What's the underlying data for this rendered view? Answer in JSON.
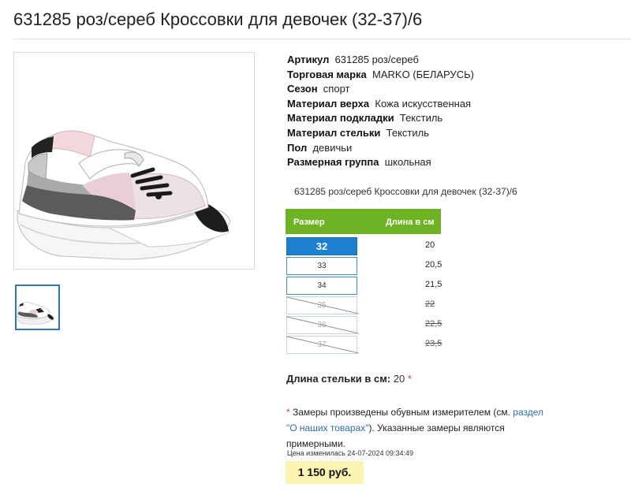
{
  "product": {
    "title": "631285 роз/сереб Кроссовки для девочек (32-37)/6",
    "subtitle": "631285 роз/сереб Кроссовки для девочек (32-37)/6",
    "image_alt": "sneaker-photo"
  },
  "properties": [
    {
      "key": "Артикул",
      "value": "631285 роз/сереб"
    },
    {
      "key": "Торговая марка",
      "value": "MARKO (БЕЛАРУСЬ)"
    },
    {
      "key": "Сезон",
      "value": "спорт"
    },
    {
      "key": "Материал верха",
      "value": "Кожа искусственная"
    },
    {
      "key": "Материал подкладки",
      "value": "Текстиль"
    },
    {
      "key": "Материал стельки",
      "value": "Текстиль"
    },
    {
      "key": "Пол",
      "value": "девичьи"
    },
    {
      "key": "Размерная группа",
      "value": "школьная"
    }
  ],
  "size_table": {
    "header_size": "Размер",
    "header_length": "Длина в см",
    "header_color": "#6eb324",
    "rows": [
      {
        "size": "32",
        "length": "20",
        "state": "selected"
      },
      {
        "size": "33",
        "length": "20,5",
        "state": "available"
      },
      {
        "size": "34",
        "length": "21,5",
        "state": "available"
      },
      {
        "size": "35",
        "length": "22",
        "state": "unavailable"
      },
      {
        "size": "36",
        "length": "22,5",
        "state": "unavailable"
      },
      {
        "size": "37",
        "length": "23,5",
        "state": "unavailable"
      }
    ]
  },
  "insole": {
    "label": "Длина стельки в см:",
    "value": "20",
    "asterisk": "*"
  },
  "note": {
    "asterisk": "*",
    "text_before": " Замеры произведены обувным измерителем (см. ",
    "link": "раздел \"О наших товарах\"",
    "text_after": "). Указанные замеры являются примерными."
  },
  "price": {
    "changed": "Цена изменилась 24-07-2024 09:34:49",
    "value": "1 150 руб.",
    "highlight_color": "#fdf4b4"
  }
}
